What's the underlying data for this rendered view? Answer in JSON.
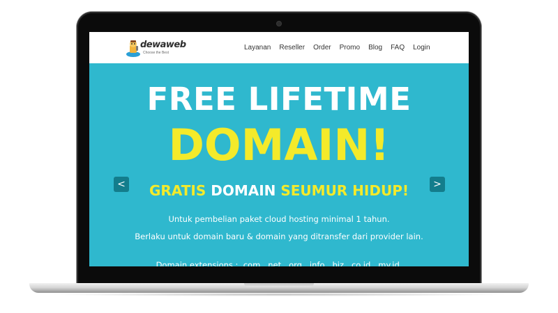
{
  "logo": {
    "name": "dewaweb",
    "tagline": "Choose the Best"
  },
  "nav": {
    "items": [
      "Layanan",
      "Reseller",
      "Order",
      "Promo",
      "Blog",
      "FAQ",
      "Login"
    ]
  },
  "hero": {
    "headline_1": "FREE LIFETIME",
    "headline_2": "DOMAIN!",
    "subtitle": {
      "part1": "GRATIS",
      "part2": "DOMAIN",
      "part3": "SEUMUR HIDUP!"
    },
    "line_1": "Untuk pembelian paket cloud hosting minimal 1 tahun.",
    "line_2": "Berlaku untuk domain baru & domain yang ditransfer dari provider lain.",
    "line_3": "Domain extensions : .com, .net, .org, .info, .biz, .co.id, .my.id,"
  },
  "carousel": {
    "prev": "<",
    "next": ">"
  },
  "colors": {
    "hero_bg": "#2fb8ce",
    "accent_yellow": "#f4ea2a",
    "arrow_bg": "#137d8c"
  }
}
